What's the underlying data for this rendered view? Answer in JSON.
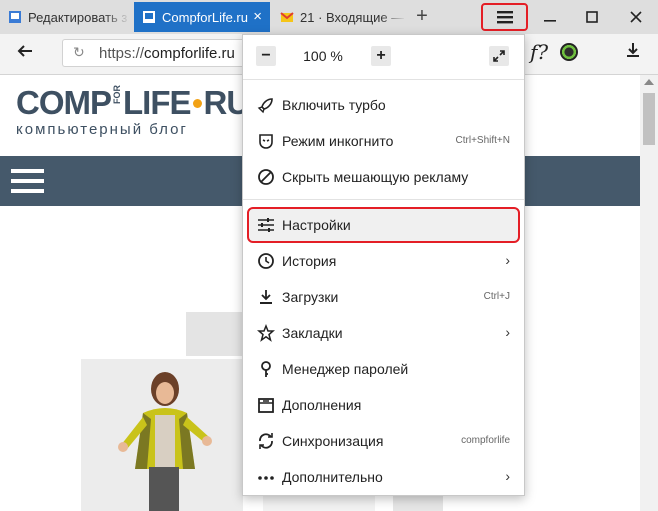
{
  "tabs": [
    {
      "title": "Редактировать з",
      "active": false
    },
    {
      "title": "CompforLife.ru",
      "active": true
    },
    {
      "title": "21 · Входящие —",
      "active": false
    }
  ],
  "new_tab_label": "+",
  "address": {
    "scheme": "https://",
    "host": "compforlife.ru"
  },
  "ext_label": "f?",
  "logo": {
    "part1": "COMP",
    "for": "FOR",
    "part2": "LIFE",
    "part3": "RU",
    "tagline": "компьютерный блог"
  },
  "menu": {
    "zoom": {
      "minus": "−",
      "value": "100 %",
      "plus": "+"
    },
    "items": [
      {
        "label": "Включить турбо",
        "icon": "rocket-icon"
      },
      {
        "label": "Режим инкогнито",
        "shortcut": "Ctrl+Shift+N",
        "icon": "incognito-mask-icon"
      },
      {
        "label": "Скрыть мешающую рекламу",
        "icon": "block-ads-icon"
      },
      {
        "label": "Настройки",
        "icon": "settings-sliders-icon",
        "highlighted": true
      },
      {
        "label": "История",
        "icon": "history-clock-icon",
        "submenu": true
      },
      {
        "label": "Загрузки",
        "shortcut": "Ctrl+J",
        "icon": "download-icon"
      },
      {
        "label": "Закладки",
        "icon": "star-icon",
        "submenu": true
      },
      {
        "label": "Менеджер паролей",
        "icon": "key-icon"
      },
      {
        "label": "Дополнения",
        "icon": "addons-icon"
      },
      {
        "label": "Синхронизация",
        "shortcut": "compforlife",
        "icon": "sync-icon"
      },
      {
        "label": "Дополнительно",
        "icon": "more-dots-icon",
        "submenu": true
      }
    ]
  },
  "colors": {
    "accent_tab": "#1f71c7",
    "highlight": "#e41e26",
    "nav_bar": "#45596b",
    "logo_dot": "#f2a215"
  }
}
